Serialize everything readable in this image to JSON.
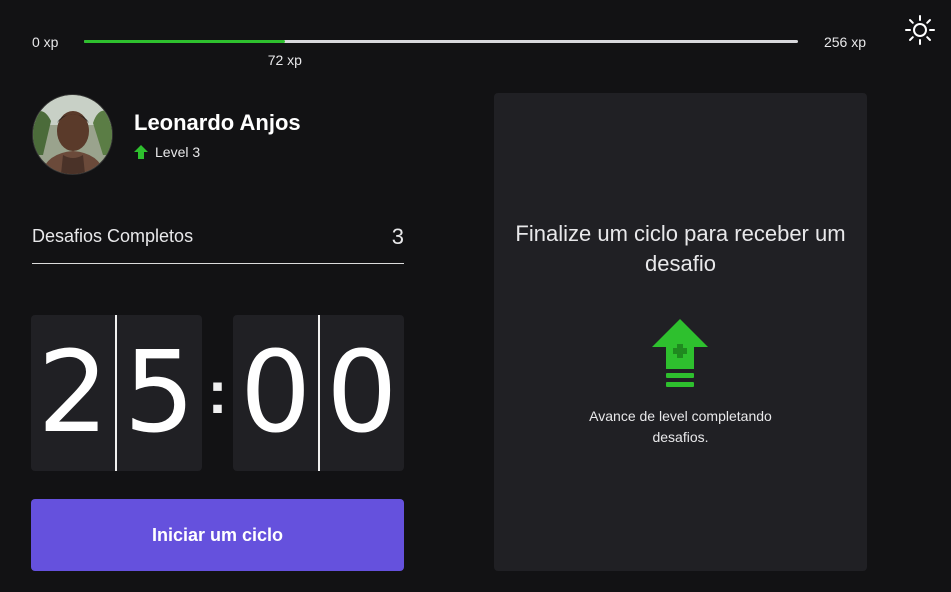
{
  "xp": {
    "min_label": "0 xp",
    "max_label": "256 xp",
    "current_label": "72 xp",
    "current": 72,
    "max": 256
  },
  "profile": {
    "name": "Leonardo Anjos",
    "level_label": "Level 3"
  },
  "stats": {
    "completed_label": "Desafios Completos",
    "completed_count": "3"
  },
  "countdown": {
    "minute_left": "2",
    "minute_right": "5",
    "separator": ":",
    "second_left": "0",
    "second_right": "0"
  },
  "actions": {
    "start_label": "Iniciar um ciclo"
  },
  "challenge": {
    "title": "Finalize um ciclo para receber um desafio",
    "hint": "Avance de level completando desafios."
  },
  "icons": {
    "theme": "sun-icon",
    "level": "level-up-arrow-icon",
    "challenge": "level-up-arrow-icon"
  },
  "colors": {
    "accent_green": "#2ec02e",
    "button_purple": "#6551dd",
    "background": "#121214",
    "card": "#202024"
  }
}
